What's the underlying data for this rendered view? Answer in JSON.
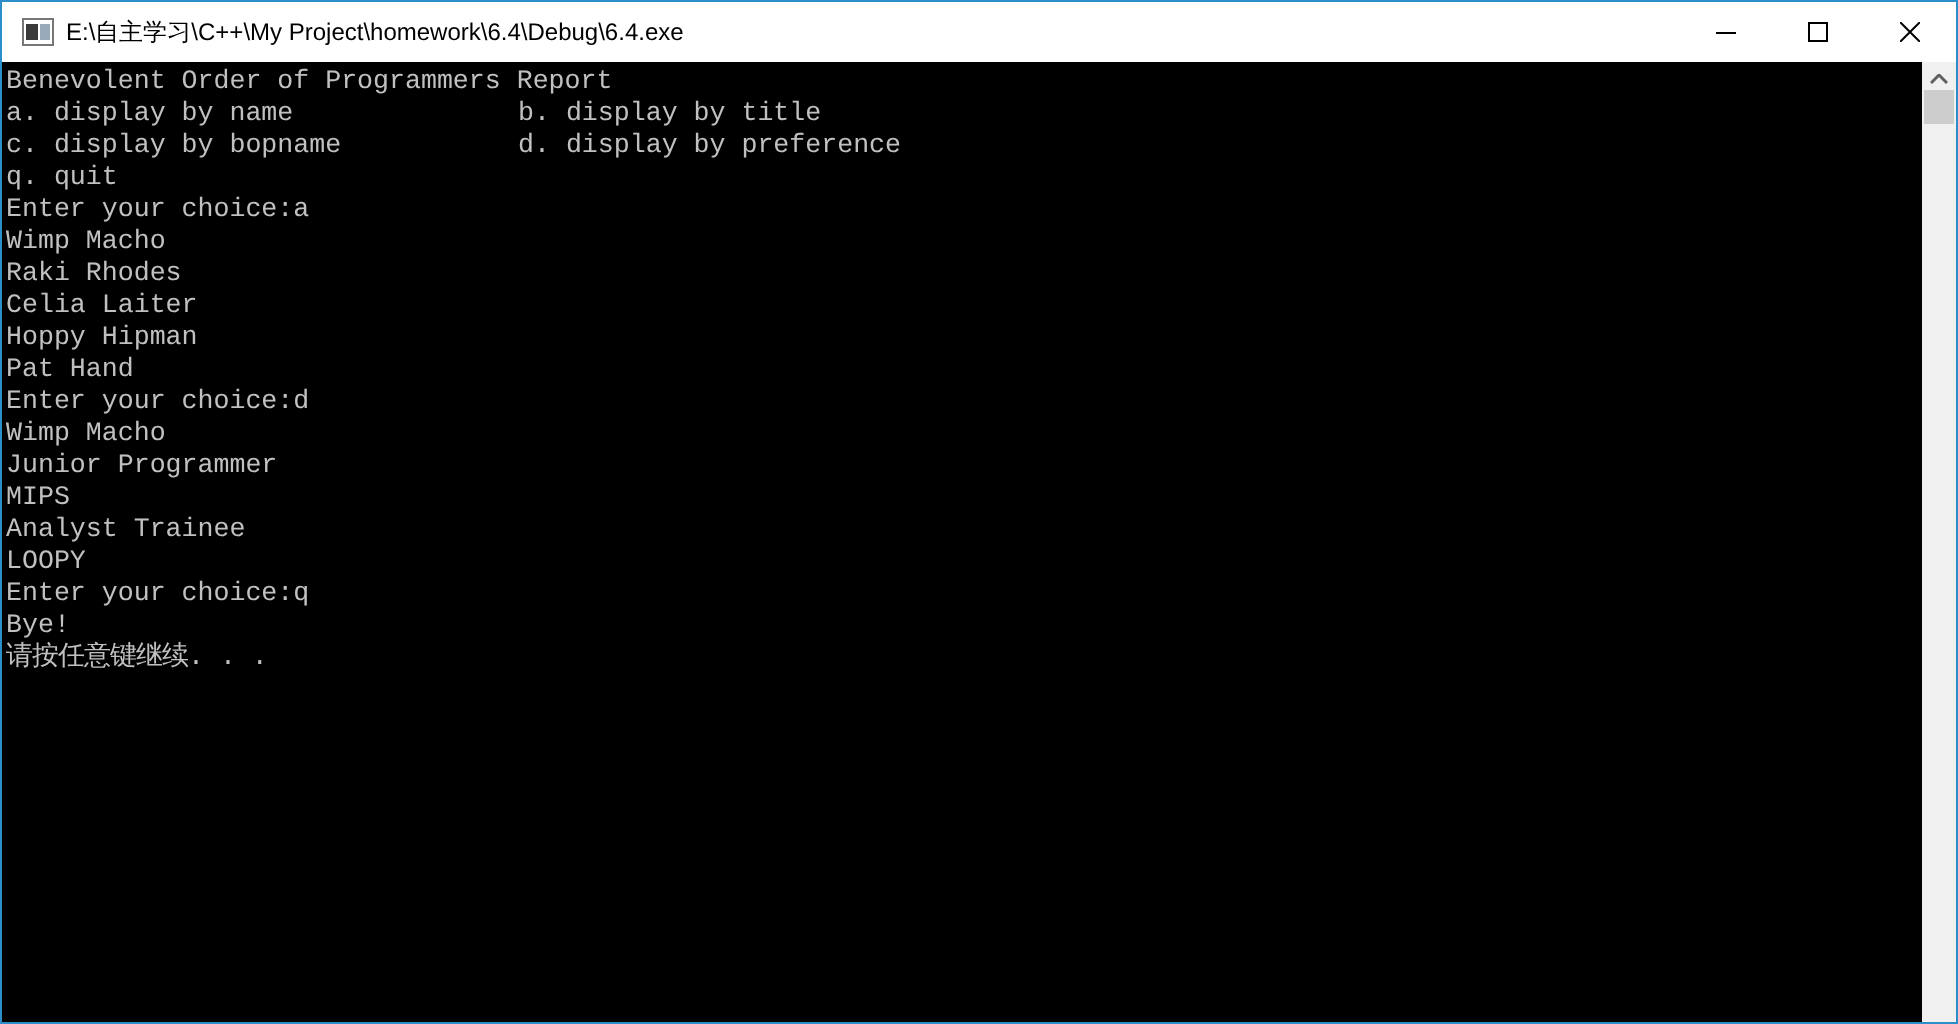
{
  "window": {
    "title": "E:\\自主学习\\C++\\My Project\\homework\\6.4\\Debug\\6.4.exe"
  },
  "console": {
    "lines": [
      {
        "kind": "text",
        "text": "Benevolent Order of Programmers Report"
      },
      {
        "kind": "columns",
        "cells": [
          "a. display by name",
          "b. display by title"
        ]
      },
      {
        "kind": "columns",
        "cells": [
          "c. display by bopname",
          "d. display by preference"
        ]
      },
      {
        "kind": "text",
        "text": "q. quit"
      },
      {
        "kind": "text",
        "text": "Enter your choice:a"
      },
      {
        "kind": "text",
        "text": "Wimp Macho"
      },
      {
        "kind": "text",
        "text": "Raki Rhodes"
      },
      {
        "kind": "text",
        "text": "Celia Laiter"
      },
      {
        "kind": "text",
        "text": "Hoppy Hipman"
      },
      {
        "kind": "text",
        "text": "Pat Hand"
      },
      {
        "kind": "text",
        "text": "Enter your choice:d"
      },
      {
        "kind": "text",
        "text": "Wimp Macho"
      },
      {
        "kind": "text",
        "text": "Junior Programmer"
      },
      {
        "kind": "text",
        "text": "MIPS"
      },
      {
        "kind": "text",
        "text": "Analyst Trainee"
      },
      {
        "kind": "text",
        "text": "LOOPY"
      },
      {
        "kind": "text",
        "text": "Enter your choice:q"
      },
      {
        "kind": "text",
        "text": "Bye!"
      },
      {
        "kind": "text",
        "text": "请按任意键继续. . ."
      }
    ]
  }
}
